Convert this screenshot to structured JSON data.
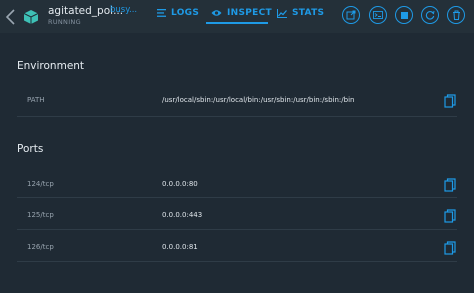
{
  "header": {
    "container_name": "agitated_poi...",
    "image_name": "busy...",
    "status": "RUNNING"
  },
  "tabs": [
    {
      "label": "LOGS",
      "icon": "list-icon"
    },
    {
      "label": "INSPECT",
      "icon": "eye-icon",
      "active": true
    },
    {
      "label": "STATS",
      "icon": "chart-icon"
    }
  ],
  "actions": [
    "open-browser-icon",
    "terminal-icon",
    "stop-icon",
    "restart-icon",
    "delete-icon"
  ],
  "environment": {
    "title": "Environment",
    "rows": [
      {
        "key": "PATH",
        "value": "/usr/local/sbin:/usr/local/bin:/usr/sbin:/usr/bin:/sbin:/bin"
      }
    ]
  },
  "ports": {
    "title": "Ports",
    "rows": [
      {
        "key": "124/tcp",
        "value": "0.0.0.0:80"
      },
      {
        "key": "125/tcp",
        "value": "0.0.0.0:443"
      },
      {
        "key": "126/tcp",
        "value": "0.0.0.0:81"
      }
    ]
  },
  "colors": {
    "accent": "#1e9ae6",
    "background": "#1f2a34",
    "header": "#243039"
  }
}
